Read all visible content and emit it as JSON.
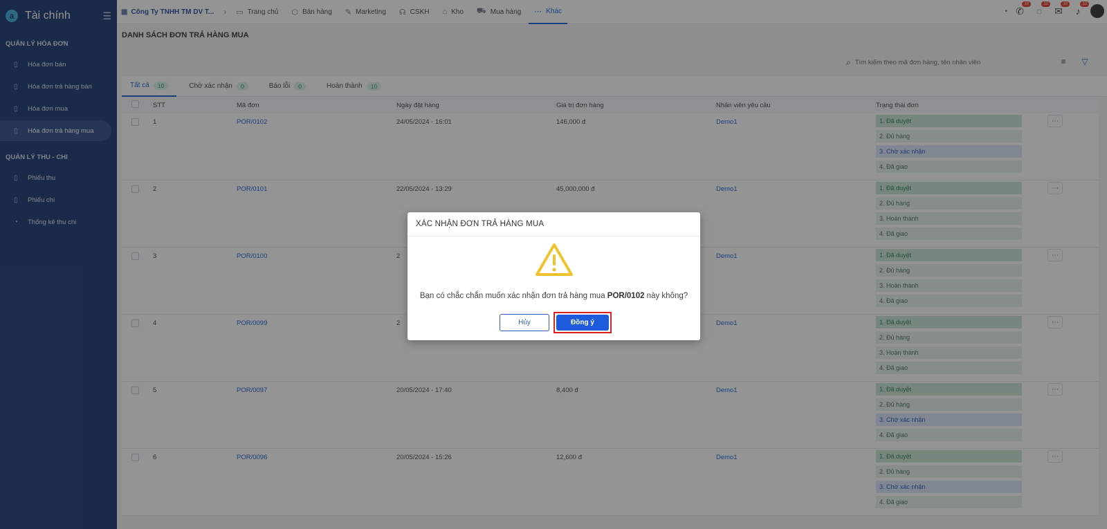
{
  "sidebar": {
    "title": "Tài chính",
    "sections": [
      {
        "label": "QUẢN LÝ HÓA ĐƠN"
      },
      {
        "label": "QUẢN LÝ THU - CHI"
      }
    ],
    "items": [
      {
        "label": "Hóa đơn bán"
      },
      {
        "label": "Hóa đơn trả hàng bán"
      },
      {
        "label": "Hóa đơn mua"
      },
      {
        "label": "Hóa đơn trả hàng mua"
      },
      {
        "label": "Phiếu thu"
      },
      {
        "label": "Phiếu chi"
      },
      {
        "label": "Thống kê thu chi"
      }
    ]
  },
  "topbar": {
    "company": "Công Ty TNHH TM DV T...",
    "nav": [
      {
        "label": "Trang chủ"
      },
      {
        "label": "Bán hàng"
      },
      {
        "label": "Marketing"
      },
      {
        "label": "CSKH"
      },
      {
        "label": "Kho"
      },
      {
        "label": "Mua hàng"
      },
      {
        "label": "Khác"
      }
    ],
    "badges": [
      "10",
      "10",
      "10",
      "10"
    ]
  },
  "main": {
    "page_title": "DANH SÁCH ĐƠN TRẢ HÀNG MUA",
    "search_placeholder": "Tìm kiếm theo mã đơn hàng, tên nhân viên",
    "tabs": [
      {
        "label": "Tất cả",
        "count": "10"
      },
      {
        "label": "Chờ xác nhận",
        "count": "0"
      },
      {
        "label": "Báo lỗi",
        "count": "0"
      },
      {
        "label": "Hoàn thành",
        "count": "10"
      }
    ],
    "columns": [
      "STT",
      "Mã đơn",
      "Ngày đặt hàng",
      "Giá trị đơn hàng",
      "Nhân viên yêu cầu",
      "Trạng thái đơn"
    ],
    "rows": [
      {
        "stt": "1",
        "ma": "POR/0102",
        "ngay": "24/05/2024 - 16:01",
        "gia": "146,000 đ",
        "nv": "Demo1",
        "statuses": [
          "1. Đã duyệt",
          "2. Đủ hàng",
          "3. Chờ xác nhận",
          "4. Đã giao"
        ]
      },
      {
        "stt": "2",
        "ma": "POR/0101",
        "ngay": "22/05/2024 - 13:29",
        "gia": "45,000,000 đ",
        "nv": "Demo1",
        "statuses": [
          "1. Đã duyệt",
          "2. Đủ hàng",
          "3. Hoàn thành",
          "4. Đã giao"
        ]
      },
      {
        "stt": "3",
        "ma": "POR/0100",
        "ngay": "2",
        "gia": "",
        "nv": "Demo1",
        "statuses": [
          "1. Đã duyệt",
          "2. Đủ hàng",
          "3. Hoàn thành",
          "4. Đã giao"
        ]
      },
      {
        "stt": "4",
        "ma": "POR/0099",
        "ngay": "2",
        "gia": "",
        "nv": "Demo1",
        "statuses": [
          "1. Đã duyệt",
          "2. Đủ hàng",
          "3. Hoàn thành",
          "4. Đã giao"
        ]
      },
      {
        "stt": "5",
        "ma": "POR/0097",
        "ngay": "20/05/2024 - 17:40",
        "gia": "8,400 đ",
        "nv": "Demo1",
        "statuses": [
          "1. Đã duyệt",
          "2. Đủ hàng",
          "3. Chờ xác nhận",
          "4. Đã giao"
        ]
      },
      {
        "stt": "6",
        "ma": "POR/0096",
        "ngay": "20/05/2024 - 15:26",
        "gia": "12,600 đ",
        "nv": "Demo1",
        "statuses": [
          "1. Đã duyệt",
          "2. Đủ hàng",
          "3. Chờ xác nhận",
          "4. Đã giao"
        ]
      }
    ]
  },
  "modal": {
    "title": "XÁC NHẬN ĐƠN TRẢ HÀNG MUA",
    "message_prefix": "Bạn có chắc chắn muốn xác nhận đơn trả hàng mua ",
    "message_code": "POR/0102",
    "message_suffix": " này không?",
    "cancel_label": "Hủy",
    "ok_label": "Đồng ý"
  },
  "colors": {
    "sidebar": "#2e4a7e",
    "accent": "#2b6fd6",
    "ok_button": "#1d5bdc",
    "highlight": "#e0201e",
    "warning": "#f2c12e"
  }
}
